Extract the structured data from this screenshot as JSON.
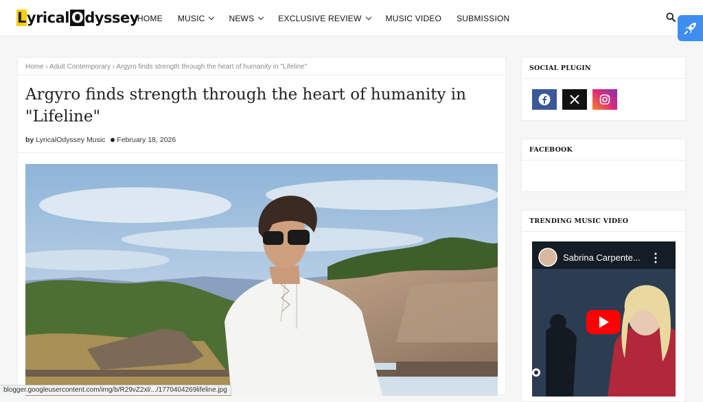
{
  "logo": {
    "part1": "L",
    "part2": "yrical",
    "part3": "O",
    "part4": "dyssey"
  },
  "nav": {
    "home": "HOME",
    "music": "MUSIC",
    "news": "NEWS",
    "review": "EXCLUSIVE REVIEW",
    "video": "MUSIC VIDEO",
    "submission": "SUBMISSION"
  },
  "breadcrumb": {
    "home": "Home",
    "sep": " › ",
    "category": "Adult Contemporary",
    "current": "Argyro finds strength through the heart of humanity in \"Lifeline\""
  },
  "article": {
    "title": "Argyro finds strength through the heart of humanity in \"Lifeline\"",
    "by": "by",
    "author": "LyricalOdyssey Music",
    "date": "February 18, 2026"
  },
  "sidebar": {
    "social_title": "SOCIAL PLUGIN",
    "facebook_title": "FACEBOOK",
    "trending_title": "TRENDING MUSIC VIDEO",
    "video_title": "Sabrina Carpente..."
  },
  "status_url": "blogger.googleusercontent.com/img/b/R29vZ2xl/.../1770404269lifeline.jpg",
  "colors": {
    "accent": "#ffd000",
    "facebook": "#3b5998",
    "x": "#111111",
    "instagram": "#c13584",
    "rocket": "#3d8ef0",
    "youtube": "#ff0000"
  }
}
